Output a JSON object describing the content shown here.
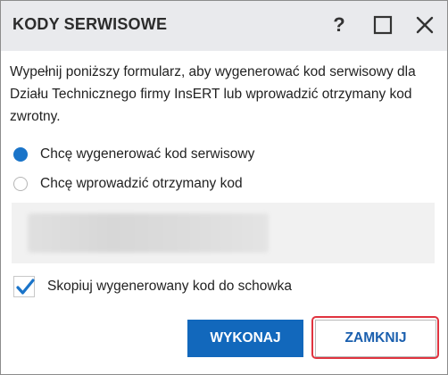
{
  "dialog": {
    "title": "KODY SERWISOWE",
    "help_icon": "help-icon",
    "maximize_icon": "maximize-icon",
    "close_icon": "close-icon"
  },
  "description": "Wypełnij poniższy formularz, aby wygenerować kod serwisowy dla Działu Technicznego firmy InsERT lub wprowadzić otrzymany kod zwrotny.",
  "options": [
    {
      "label": "Chcę wygenerować kod serwisowy",
      "selected": true
    },
    {
      "label": "Chcę wprowadzić otrzymany kod",
      "selected": false
    }
  ],
  "code_field": {
    "blurred": true
  },
  "copy_checkbox": {
    "label": "Skopiuj wygenerowany kod do schowka",
    "checked": true
  },
  "buttons": {
    "execute": "WYKONAJ",
    "close": "ZAMKNIJ"
  },
  "colors": {
    "accent": "#1a74c9",
    "primary_button": "#1268bc",
    "highlight": "#e0333f",
    "titlebar": "#e9eaed"
  }
}
